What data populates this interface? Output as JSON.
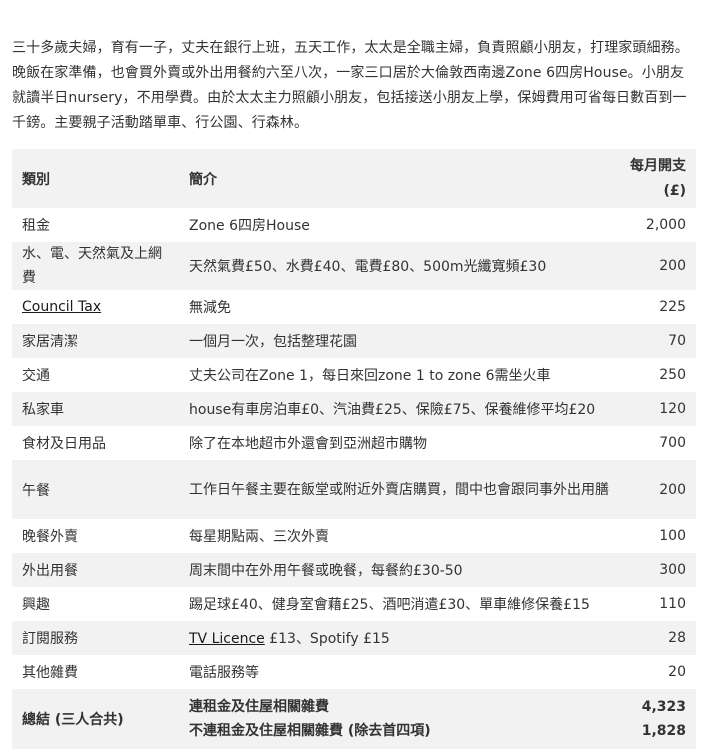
{
  "intro": "三十多歲夫婦，育有一子，丈夫在銀行上班，五天工作，太太是全職主婦，負責照顧小朋友，打理家頭細務。晚飯在家準備，也會買外賣或外出用餐約六至八次，一家三口居於大倫敦西南邊Zone 6四房House。小朋友就讀半日nursery，不用學費。由於太太主力照顧小朋友，包括接送小朋友上學，保姆費用可省每日數百到一千鎊。主要親子活動踏單車、行公園、行森林。",
  "table": {
    "headers": {
      "category": "類別",
      "desc": "簡介",
      "amount_line1": "每月開支",
      "amount_line2": "(£)"
    },
    "rows": [
      {
        "category": "租金",
        "desc": "Zone 6四房House",
        "amount": "2,000"
      },
      {
        "category": "水、電、天然氣及上網費",
        "desc": "天然氣費£50、水費£40、電費£80、500m光纖寬頻£30",
        "amount": "200"
      },
      {
        "category": "Council Tax",
        "desc": "無減免",
        "amount": "225"
      },
      {
        "category": "家居清潔",
        "desc": "一個月一次，包括整理花園",
        "amount": "70"
      },
      {
        "category": "交通",
        "desc": "丈夫公司在Zone 1，每日來回zone 1 to zone 6需坐火車",
        "amount": "250"
      },
      {
        "category": "私家車",
        "desc": "house有車房泊車£0、汽油費£25、保險£75、保養維修平均£20",
        "amount": "120"
      },
      {
        "category": "食材及日用品",
        "desc": "除了在本地超市外還會到亞洲超市購物",
        "amount": "700"
      },
      {
        "category": "午餐",
        "desc": "工作日午餐主要在飯堂或附近外賣店購買，間中也會跟同事外出用膳",
        "amount": "200"
      },
      {
        "category": "晚餐外賣",
        "desc": "每星期點兩、三次外賣",
        "amount": "100"
      },
      {
        "category": "外出用餐",
        "desc": "周末間中在外用午餐或晚餐，每餐約£30-50",
        "amount": "300"
      },
      {
        "category": "興趣",
        "desc": "踢足球£40、健身室會藉£25、酒吧消遣£30、單車維修保養£15",
        "amount": "110"
      },
      {
        "category": "訂閱服務",
        "desc_link": "TV Licence",
        "desc_rest": " £13、Spotify £15",
        "amount": "28"
      },
      {
        "category": "其他雜費",
        "desc": "電話服務等",
        "amount": "20"
      }
    ],
    "total": {
      "category": "總結 (三人合共)",
      "line1_label": "連租金及住屋相關雜費",
      "line1_amount": "4,323",
      "line2_label": "不連租金及住屋相關雜費 (除去首四項)",
      "line2_amount": "1,828"
    }
  }
}
